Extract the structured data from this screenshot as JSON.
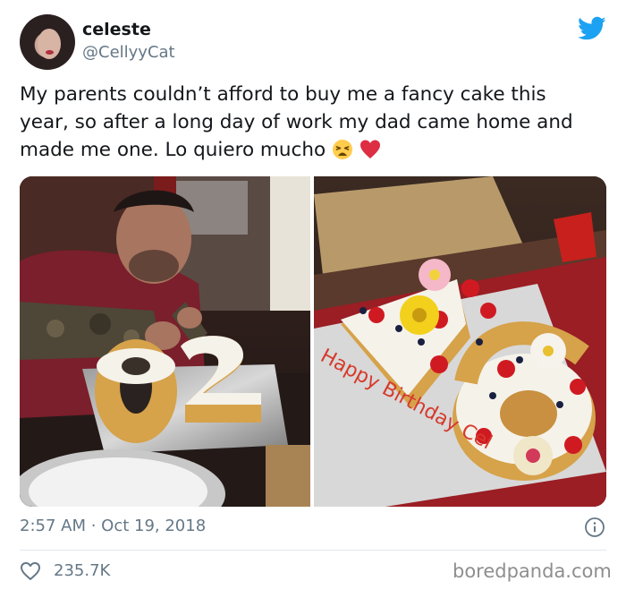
{
  "user": {
    "name": "celeste",
    "handle": "@CellyyCat"
  },
  "tweet": {
    "text": "My parents couldn’t afford to buy me a fancy cake this year, so after a long day of work my dad came home and made me one. Lo quiero mucho",
    "emojis": [
      "weary-face-icon",
      "red-heart-icon"
    ],
    "timestamp": "2:57 AM · Oct 19, 2018",
    "likes": "235.7K"
  },
  "images": {
    "left": "man decorating number cake",
    "right": "decorated number 16 birthday cake with fruit and flowers",
    "cake_writing": "Happy Birthday Cel"
  },
  "colors": {
    "twitter_blue": "#1da1f2",
    "secondary_text": "#657786",
    "divider": "#e1e8ed"
  },
  "watermark": "boredpanda.com"
}
